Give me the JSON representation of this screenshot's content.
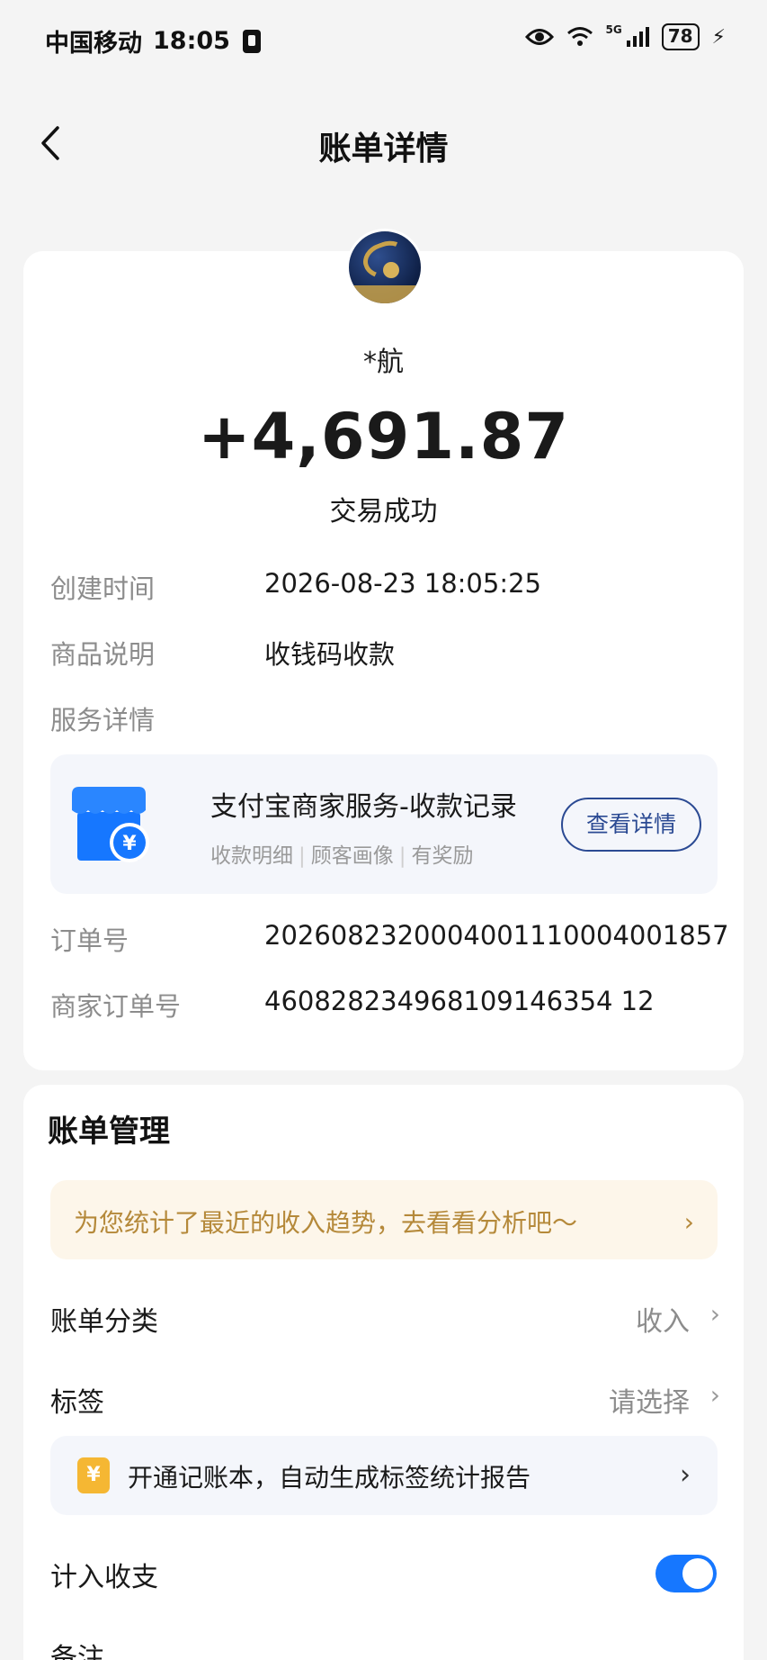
{
  "status_bar": {
    "carrier": "中国移动",
    "time": "18:05",
    "network": "5G",
    "battery": "78",
    "icons": [
      "eye-icon",
      "wifi-icon",
      "signal-icon",
      "battery-icon",
      "charging-icon"
    ]
  },
  "nav": {
    "title": "账单详情",
    "back_icon": "chevron-left-icon"
  },
  "transaction": {
    "payer_name": "*航",
    "amount": "+4,691.87",
    "status": "交易成功",
    "created_label": "创建时间",
    "created_value": "2026-08-23 18:05:25",
    "product_label": "商品说明",
    "product_value": "收钱码收款",
    "service_label": "服务详情",
    "order_label": "订单号",
    "order_value": "2026082320004001110004001857",
    "merchant_order_label": "商家订单号",
    "merchant_order_value": "460828234968109146354 12"
  },
  "service": {
    "title": "支付宝商家服务-收款记录",
    "sub1": "收款明细",
    "sub2": "顾客画像",
    "sub3": "有奖励",
    "button": "查看详情",
    "icon": "store-yuan-icon",
    "accent": "#2b4a93"
  },
  "manage": {
    "title": "账单管理",
    "tip": "为您统计了最近的收入趋势，去看看分析吧～",
    "category_label": "账单分类",
    "category_value": "收入",
    "tag_label": "标签",
    "tag_value": "请选择",
    "ledger_text": "开通记账本，自动生成标签统计报告",
    "ledger_icon_text": "¥",
    "income_label": "计入收支",
    "income_enabled": true,
    "note_label": "备注",
    "toggle_color": "#1677ff"
  }
}
